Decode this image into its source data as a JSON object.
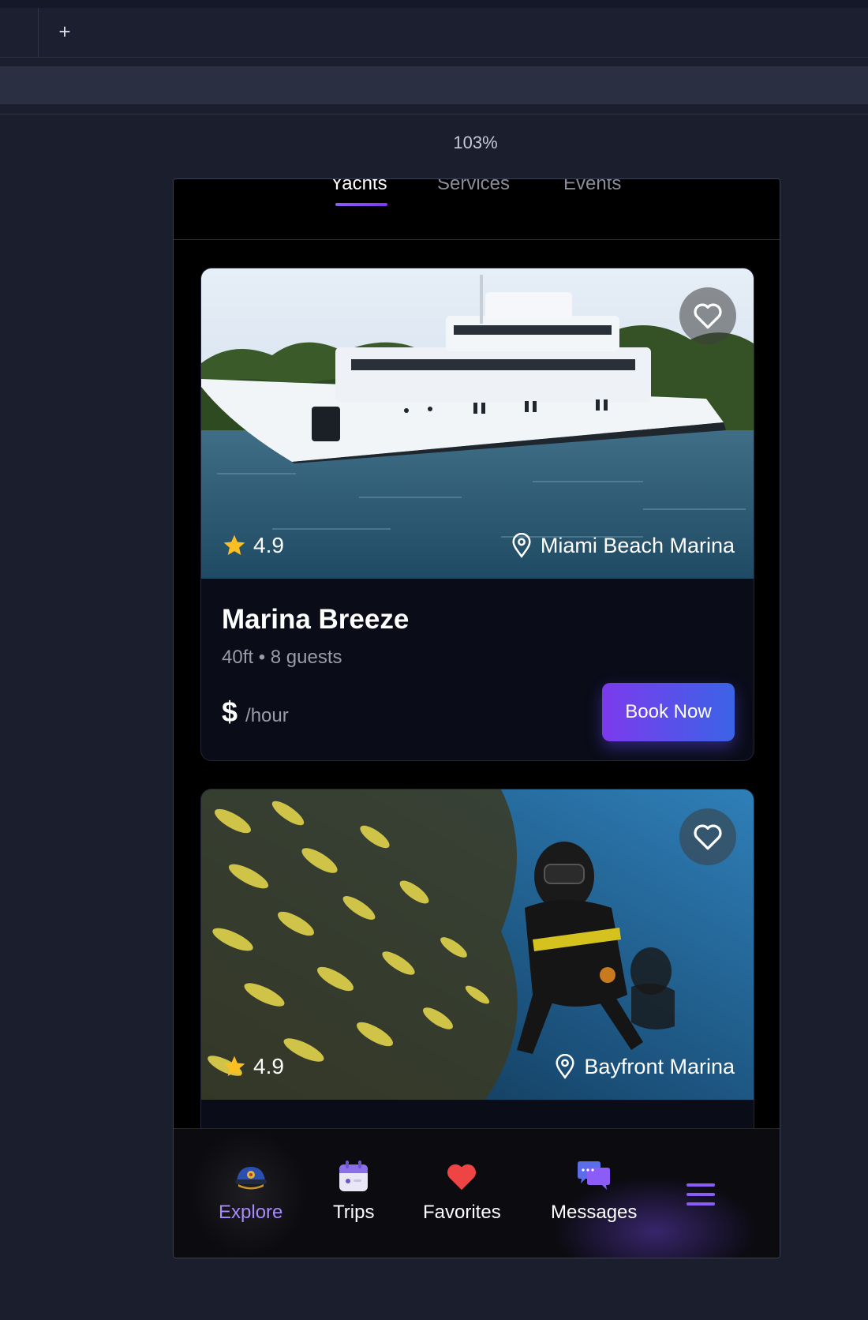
{
  "browser": {
    "new_tab_label": "+",
    "zoom": "103%"
  },
  "categories": [
    {
      "label": "Yachts",
      "active": true
    },
    {
      "label": "Services",
      "active": false
    },
    {
      "label": "Events",
      "active": false
    }
  ],
  "listings": [
    {
      "rating": "4.9",
      "location": "Miami Beach Marina",
      "name": "Marina Breeze",
      "specs": "40ft • 8 guests",
      "price_symbol": "$",
      "price_unit": "/hour",
      "cta": "Book Now",
      "image": "yacht-photo"
    },
    {
      "rating": "4.9",
      "location": "Bayfront Marina",
      "image": "scuba-diver-photo"
    }
  ],
  "bottom_nav": {
    "items": [
      {
        "label": "Explore",
        "icon": "captain-hat-icon",
        "active": true
      },
      {
        "label": "Trips",
        "icon": "calendar-icon",
        "active": false
      },
      {
        "label": "Favorites",
        "icon": "heart-icon",
        "active": false
      },
      {
        "label": "Messages",
        "icon": "chat-bubbles-icon",
        "active": false
      }
    ],
    "menu_icon": "hamburger-menu-icon"
  },
  "colors": {
    "accent": "#8b5cf6",
    "button_gradient_start": "#7c3aed",
    "button_gradient_end": "#3b63e6",
    "star": "#fbbf24",
    "favorite": "#ef4444"
  }
}
